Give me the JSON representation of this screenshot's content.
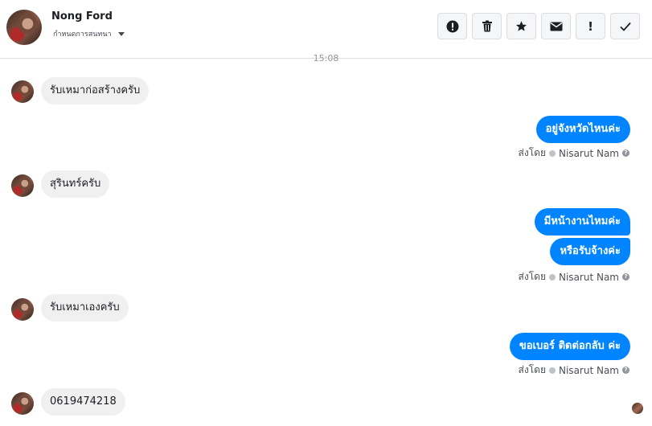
{
  "header": {
    "contact_name": "Nong Ford",
    "conversation_menu": "กำหนดการสนทนา"
  },
  "toolbar": [
    {
      "icon": "report-icon",
      "glyph": "!"
    },
    {
      "icon": "trash-icon",
      "glyph": ""
    },
    {
      "icon": "star-icon",
      "glyph": "★"
    },
    {
      "icon": "envelope-icon",
      "glyph": "✉"
    },
    {
      "icon": "important-icon",
      "glyph": "!"
    },
    {
      "icon": "check-icon",
      "glyph": "✓"
    }
  ],
  "timestamp": "15:08",
  "messages": {
    "in_1": "รับเหมาก่อสร้างครับ",
    "out_1": "อยู่จังหวัดไหนค่ะ",
    "in_2": "สุรินทร์ครับ",
    "out_2": "มีหน้างานไหมค่ะ",
    "out_3": "หรือรับจ้างค่ะ",
    "in_3": "รับเหมาเองครับ",
    "out_4": "ขอเบอร์ ติดต่อกลับ ค่ะ",
    "in_4": "0619474218"
  },
  "sent_by": {
    "prefix": "ส่งโดย",
    "name": "Nisarut Nam"
  }
}
